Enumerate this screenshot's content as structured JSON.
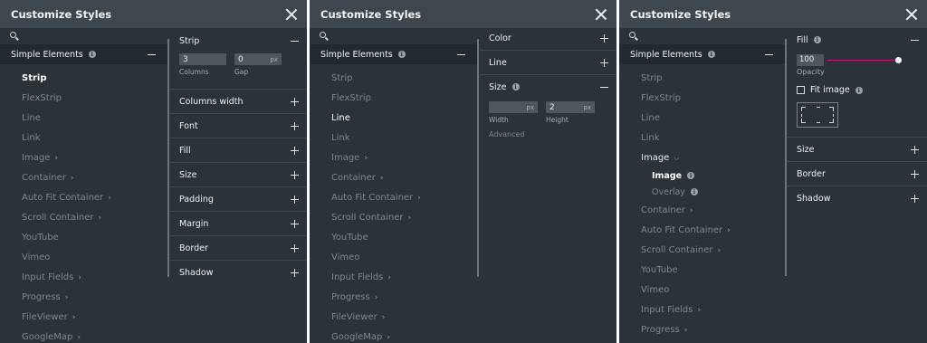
{
  "panels": [
    {
      "title": "Customize Styles",
      "section": "Simple Elements",
      "elements": [
        "Strip",
        "FlexStrip",
        "Line",
        "Link",
        "Image",
        "Container",
        "Auto Fit Container",
        "Scroll Container",
        "YouTube",
        "Vimeo",
        "Input Fields",
        "Progress",
        "FileViewer",
        "GoogleMap"
      ],
      "strip": {
        "title": "Strip",
        "columns_value": "3",
        "columns_label": "Columns",
        "gap_value": "0",
        "gap_unit": "px",
        "gap_label": "Gap"
      },
      "props": [
        "Columns width",
        "Font",
        "Fill",
        "Size",
        "Padding",
        "Margin",
        "Border",
        "Shadow"
      ]
    },
    {
      "title": "Customize Styles",
      "section": "Simple Elements",
      "elements": [
        "Strip",
        "FlexStrip",
        "Line",
        "Link",
        "Image",
        "Container",
        "Auto Fit Container",
        "Scroll Container",
        "YouTube",
        "Vimeo",
        "Input Fields",
        "Progress",
        "FileViewer",
        "GoogleMap"
      ],
      "props_top": [
        "Color",
        "Line"
      ],
      "size": {
        "title": "Size",
        "width_value": "",
        "width_unit": "px",
        "width_label": "Width",
        "height_value": "2",
        "height_unit": "px",
        "height_label": "Height",
        "advanced": "Advanced"
      }
    },
    {
      "title": "Customize Styles",
      "section": "Simple Elements",
      "elements_before": [
        "Strip",
        "FlexStrip",
        "Line",
        "Link"
      ],
      "image_label": "Image",
      "image_subs": [
        "Image",
        "Overlay"
      ],
      "elements_after": [
        "Container",
        "Auto Fit Container",
        "Scroll Container",
        "YouTube",
        "Vimeo",
        "Input Fields",
        "Progress"
      ],
      "fill": {
        "title": "Fill",
        "opacity_value": "100",
        "opacity_label": "Opacity",
        "opacity_fraction": 1.0,
        "fit_image_label": "Fit image"
      },
      "props": [
        "Size",
        "Border",
        "Shadow"
      ]
    }
  ],
  "colors": {
    "panel_bg": "#2b3338",
    "header_bg": "#3e474d",
    "accent_slider": "#c2187a"
  },
  "icons": {
    "close": "close-icon",
    "search": "search-icon",
    "info": "info-icon",
    "expand": "plus-icon",
    "collapse": "minus-icon",
    "chevron": "chevron-right-icon"
  }
}
